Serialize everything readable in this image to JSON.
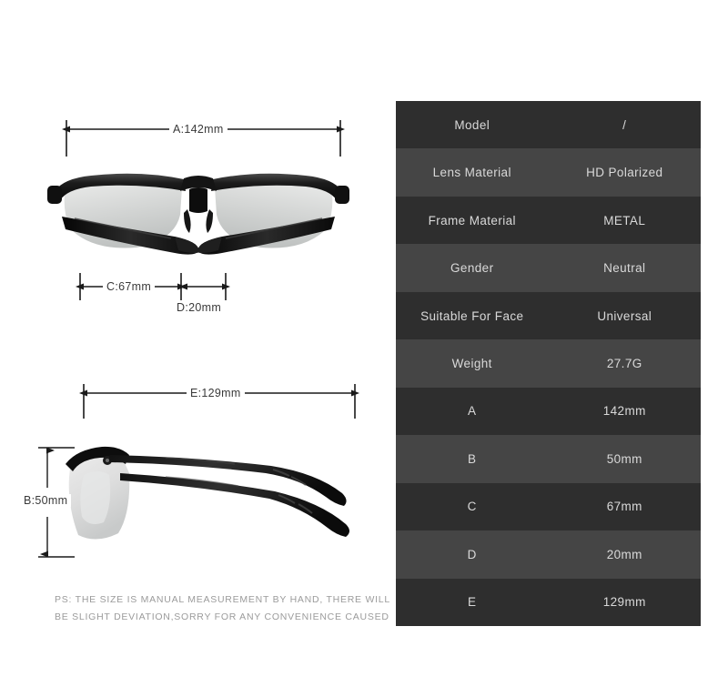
{
  "spec_table": {
    "rows": [
      {
        "key": "Model",
        "value": "/"
      },
      {
        "key": "Lens Material",
        "value": "HD Polarized"
      },
      {
        "key": "Frame Material",
        "value": "METAL"
      },
      {
        "key": "Gender",
        "value": "Neutral"
      },
      {
        "key": "Suitable For Face",
        "value": "Universal"
      },
      {
        "key": "Weight",
        "value": "27.7G"
      },
      {
        "key": "A",
        "value": "142mm"
      },
      {
        "key": "B",
        "value": "50mm"
      },
      {
        "key": "C",
        "value": "67mm"
      },
      {
        "key": "D",
        "value": "20mm"
      },
      {
        "key": "E",
        "value": "129mm"
      }
    ],
    "row_color_odd": "#2e2e2e",
    "row_color_even": "#454545",
    "text_color": "#d9d9d9"
  },
  "dimensions": {
    "a": "A:142mm",
    "b": "B:50mm",
    "c": "C:67mm",
    "d": "D:20mm",
    "e": "E:129mm",
    "line_color": "#1a1a1a"
  },
  "disclaimer": {
    "line1": "PS: THE SIZE IS MANUAL MEASUREMENT BY HAND, THERE WILL",
    "line2": "BE SLIGHT DEVIATION,SORRY FOR ANY CONVENIENCE CAUSED",
    "color": "#9b9b9b"
  },
  "product": {
    "front_view_name": "sunglasses-front-view",
    "side_view_name": "sunglasses-side-view",
    "frame_color": "#111111",
    "lens_color": "#d5d7d6"
  }
}
